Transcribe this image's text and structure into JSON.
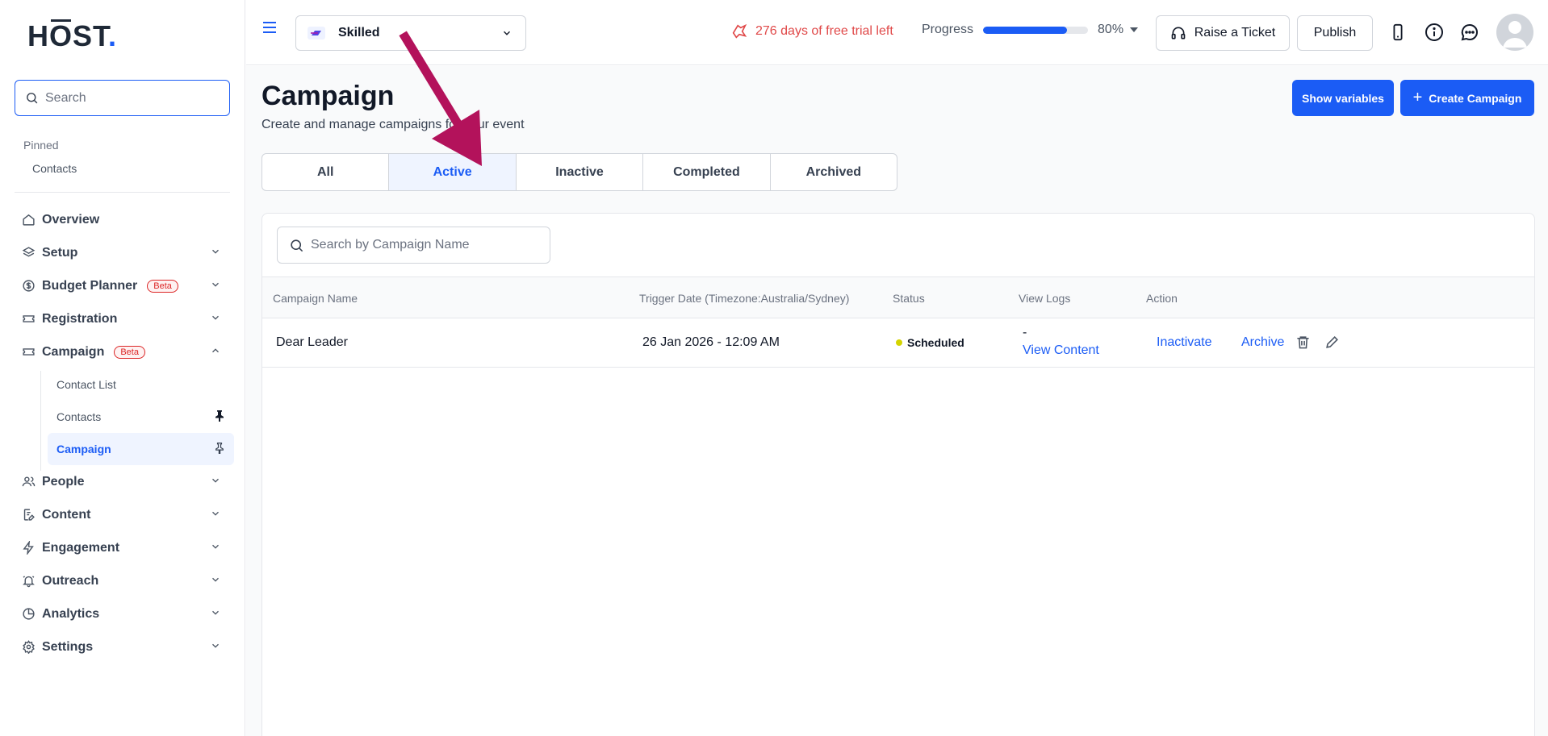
{
  "brand": {
    "logo_main": "H",
    "logo_o": "O",
    "logo_rest": "ST",
    "logo_dot": ".",
    "accent": "#1b5cf5"
  },
  "sidebar": {
    "search_placeholder": "Search",
    "pinned_title": "Pinned",
    "pinned_items": [
      "Contacts"
    ],
    "nav": [
      {
        "label": "Overview",
        "icon": "home-icon"
      },
      {
        "label": "Setup",
        "icon": "layers-icon"
      },
      {
        "label": "Budget Planner",
        "icon": "dollar-circle-icon",
        "badge": "Beta"
      },
      {
        "label": "Registration",
        "icon": "ticket-icon"
      },
      {
        "label": "Campaign",
        "icon": "ticket-icon",
        "badge": "Beta",
        "expanded": true
      },
      {
        "label": "People",
        "icon": "users-icon"
      },
      {
        "label": "Content",
        "icon": "document-edit-icon"
      },
      {
        "label": "Engagement",
        "icon": "bolt-icon"
      },
      {
        "label": "Outreach",
        "icon": "bell-icon"
      },
      {
        "label": "Analytics",
        "icon": "pie-chart-icon"
      },
      {
        "label": "Settings",
        "icon": "gear-icon"
      }
    ],
    "campaign_sub": [
      "Contact List",
      "Contacts",
      "Campaign"
    ]
  },
  "topbar": {
    "event_name": "Skilled",
    "trial_text": "276 days of free trial left",
    "progress_label": "Progress",
    "progress_value": 0.8,
    "progress_text": "80%",
    "ticket_label": "Raise a Ticket",
    "publish_label": "Publish"
  },
  "page": {
    "title": "Campaign",
    "subtitle": "Create and manage campaigns for your event",
    "show_variables": "Show variables",
    "create_campaign": "Create Campaign",
    "tabs": [
      "All",
      "Active",
      "Inactive",
      "Completed",
      "Archived"
    ],
    "active_tab": "Active",
    "search_placeholder": "Search by Campaign Name",
    "columns": [
      "Campaign Name",
      "Trigger Date (Timezone:Australia/Sydney)",
      "Status",
      "View Logs",
      "Action"
    ],
    "rows": [
      {
        "name": "Dear Leader",
        "trigger": "26 Jan 2026 - 12:09 AM",
        "status": "Scheduled",
        "logs_dash": "-",
        "logs_link": "View Content",
        "action_inactivate": "Inactivate",
        "action_archive": "Archive"
      }
    ]
  }
}
